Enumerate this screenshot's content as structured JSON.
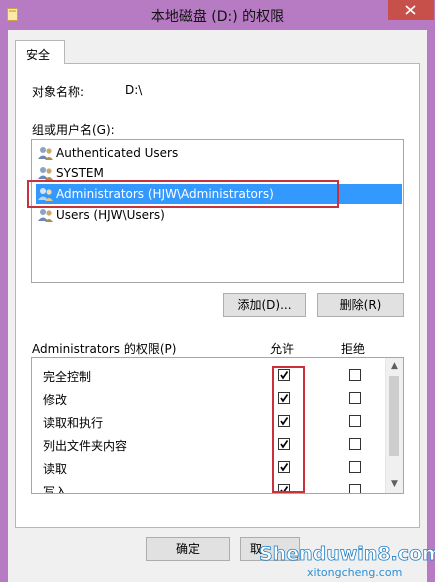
{
  "window": {
    "title": "本地磁盘 (D:) 的权限"
  },
  "tabs": [
    {
      "label": "安全"
    }
  ],
  "object": {
    "label": "对象名称:",
    "value": "D:\\"
  },
  "groups": {
    "label": "组或用户名(G):",
    "items": [
      {
        "label": "Authenticated Users",
        "selected": false
      },
      {
        "label": "SYSTEM",
        "selected": false
      },
      {
        "label": "Administrators (HJW\\Administrators)",
        "selected": true
      },
      {
        "label": "Users (HJW\\Users)",
        "selected": false
      }
    ]
  },
  "buttons": {
    "add": "添加(D)...",
    "remove": "删除(R)",
    "ok": "确定",
    "cancel": "取"
  },
  "permissions": {
    "label": "Administrators 的权限(P)",
    "allow_header": "允许",
    "deny_header": "拒绝",
    "rows": [
      {
        "label": "完全控制",
        "allow": true,
        "deny": false
      },
      {
        "label": "修改",
        "allow": true,
        "deny": false
      },
      {
        "label": "读取和执行",
        "allow": true,
        "deny": false
      },
      {
        "label": "列出文件夹内容",
        "allow": true,
        "deny": false
      },
      {
        "label": "读取",
        "allow": true,
        "deny": false
      },
      {
        "label": "写入",
        "allow": true,
        "deny": false
      }
    ]
  },
  "watermark": {
    "main": "Shenduwin8.com",
    "sub": "xitongcheng.com"
  },
  "colors": {
    "frame": "#b77bc4",
    "selection": "#3399ff",
    "highlight": "#c8323a",
    "close": "#c7504a"
  }
}
